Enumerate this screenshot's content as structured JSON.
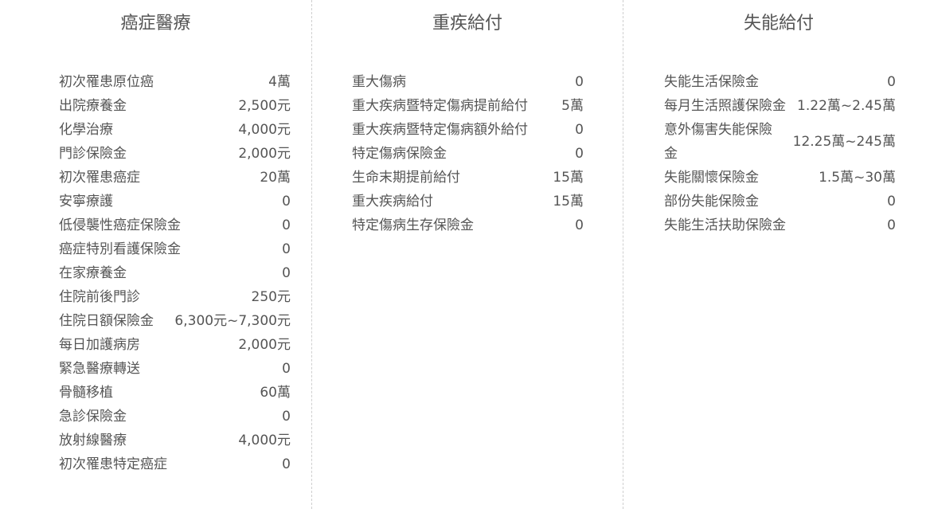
{
  "columns": [
    {
      "title": "癌症醫療",
      "items": [
        {
          "label": "初次罹患原位癌",
          "value": "4萬"
        },
        {
          "label": "出院療養金",
          "value": "2,500元"
        },
        {
          "label": "化學治療",
          "value": "4,000元"
        },
        {
          "label": "門診保險金",
          "value": "2,000元"
        },
        {
          "label": "初次罹患癌症",
          "value": "20萬"
        },
        {
          "label": "安寧療護",
          "value": "0"
        },
        {
          "label": "低侵襲性癌症保險金",
          "value": "0"
        },
        {
          "label": "癌症特別看護保險金",
          "value": "0"
        },
        {
          "label": "在家療養金",
          "value": "0"
        },
        {
          "label": "住院前後門診",
          "value": "250元"
        },
        {
          "label": "住院日額保險金",
          "value": "6,300元~7,300元"
        },
        {
          "label": "每日加護病房",
          "value": "2,000元"
        },
        {
          "label": "緊急醫療轉送",
          "value": "0"
        },
        {
          "label": "骨髓移植",
          "value": "60萬"
        },
        {
          "label": "急診保險金",
          "value": "0"
        },
        {
          "label": "放射線醫療",
          "value": "4,000元"
        },
        {
          "label": "初次罹患特定癌症",
          "value": "0"
        }
      ]
    },
    {
      "title": "重疾給付",
      "items": [
        {
          "label": "重大傷病",
          "value": "0"
        },
        {
          "label": "重大疾病暨特定傷病提前給付",
          "value": "5萬"
        },
        {
          "label": "重大疾病暨特定傷病額外給付",
          "value": "0"
        },
        {
          "label": "特定傷病保險金",
          "value": "0"
        },
        {
          "label": "生命末期提前給付",
          "value": "15萬"
        },
        {
          "label": "重大疾病給付",
          "value": "15萬"
        },
        {
          "label": "特定傷病生存保險金",
          "value": "0"
        }
      ]
    },
    {
      "title": "失能給付",
      "items": [
        {
          "label": "失能生活保險金",
          "value": "0"
        },
        {
          "label": "每月生活照護保險金",
          "value": "1.22萬~2.45萬"
        },
        {
          "label": "意外傷害失能保險金",
          "value": "12.25萬~245萬"
        },
        {
          "label": "失能關懷保險金",
          "value": "1.5萬~30萬"
        },
        {
          "label": "部份失能保險金",
          "value": "0"
        },
        {
          "label": "失能生活扶助保險金",
          "value": "0"
        }
      ]
    }
  ]
}
